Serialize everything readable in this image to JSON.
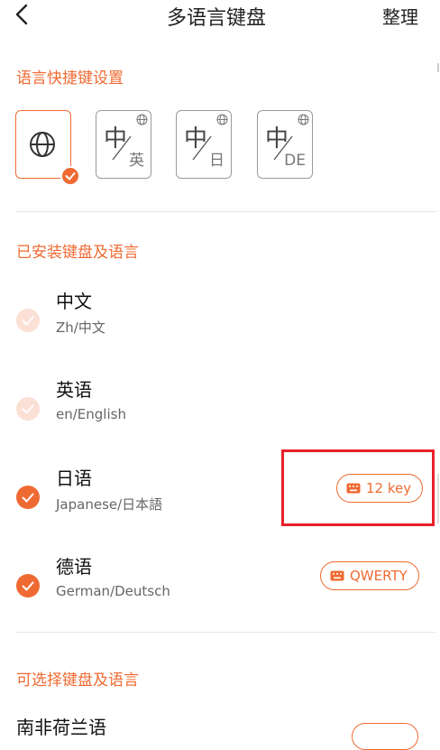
{
  "header": {
    "title": "多语言键盘",
    "organize_label": "整理"
  },
  "shortcut_section": {
    "title": "语言快捷键设置",
    "options": [
      {
        "icon": "globe-icon",
        "selected": true
      },
      {
        "main": "中",
        "sub": "英"
      },
      {
        "main": "中",
        "sub": "日"
      },
      {
        "main": "中",
        "sub": "DE"
      }
    ]
  },
  "installed_section": {
    "title": "已安装键盘及语言",
    "languages": [
      {
        "name": "中文",
        "subtitle": "Zh/中文",
        "checked": true,
        "locked": true
      },
      {
        "name": "英语",
        "subtitle": "en/English",
        "checked": true,
        "locked": true
      },
      {
        "name": "日语",
        "subtitle": "Japanese/日本語",
        "checked": true,
        "layout": "12 key"
      },
      {
        "name": "德语",
        "subtitle": "German/Deutsch",
        "checked": true,
        "layout": "QWERTY"
      }
    ]
  },
  "available_section": {
    "title": "可选择键盘及语言",
    "languages": [
      {
        "name": "南非荷兰语"
      }
    ]
  },
  "colors": {
    "accent": "#ef6a32",
    "highlight": "#e8202a"
  }
}
